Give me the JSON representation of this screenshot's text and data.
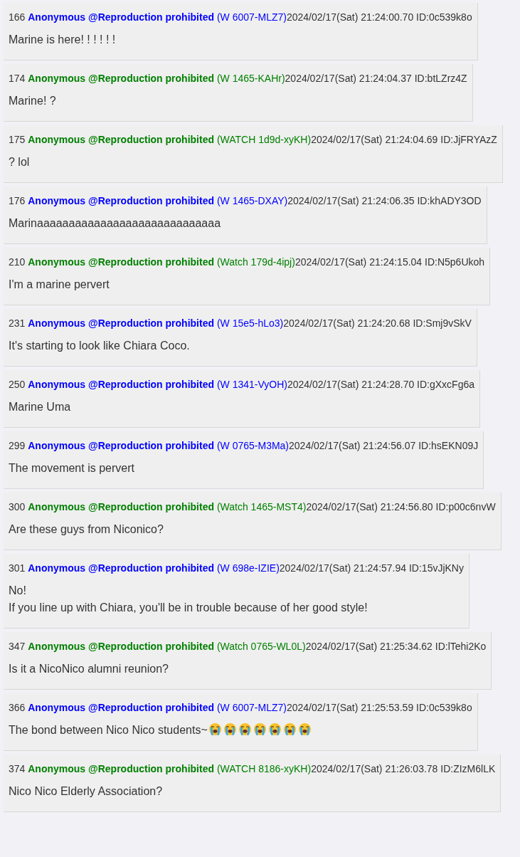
{
  "posts": [
    {
      "number": "166",
      "name": "Anonymous @Reproduction prohibited",
      "color": "#0000ff",
      "tag": "(W 6007-MLZ7)",
      "date": "2024/02/17(Sat) 21:24:00.70",
      "id": "ID:0c539k8o",
      "lines": [
        "Marine is here! ! ! ! ! !"
      ]
    },
    {
      "number": "174",
      "name": "Anonymous @Reproduction prohibited",
      "color": "#008000",
      "tag": "(W 1465-KAHr)",
      "date": "2024/02/17(Sat) 21:24:04.37",
      "id": "ID:btLZrz4Z",
      "lines": [
        "Marine! ?"
      ]
    },
    {
      "number": "175",
      "name": "Anonymous @Reproduction prohibited",
      "color": "#008000",
      "tag": "(WATCH 1d9d-xyKH)",
      "date": "2024/02/17(Sat) 21:24:04.69",
      "id": "ID:JjFRYAzZ",
      "lines": [
        "? lol"
      ]
    },
    {
      "number": "176",
      "name": "Anonymous @Reproduction prohibited",
      "color": "#0000ff",
      "tag": "(W 1465-DXAY)",
      "date": "2024/02/17(Sat) 21:24:06.35",
      "id": "ID:khADY3OD",
      "lines": [
        "Marinaaaaaaaaaaaaaaaaaaaaaaaaaaaaa"
      ]
    },
    {
      "number": "210",
      "name": "Anonymous @Reproduction prohibited",
      "color": "#008000",
      "tag": "(Watch 179d-4ipj)",
      "date": "2024/02/17(Sat) 21:24:15.04",
      "id": "ID:N5p6Ukoh",
      "lines": [
        "I'm a marine pervert"
      ]
    },
    {
      "number": "231",
      "name": "Anonymous @Reproduction prohibited",
      "color": "#0000ff",
      "tag": "(W 15e5-hLo3)",
      "date": "2024/02/17(Sat) 21:24:20.68",
      "id": "ID:Smj9vSkV",
      "lines": [
        "It's starting to look like Chiara Coco."
      ]
    },
    {
      "number": "250",
      "name": "Anonymous @Reproduction prohibited",
      "color": "#0000ff",
      "tag": "(W 1341-VyOH)",
      "date": "2024/02/17(Sat) 21:24:28.70",
      "id": "ID:gXxcFg6a",
      "lines": [
        "Marine Uma"
      ]
    },
    {
      "number": "299",
      "name": "Anonymous @Reproduction prohibited",
      "color": "#0000ff",
      "tag": "(W 0765-M3Ma)",
      "date": "2024/02/17(Sat) 21:24:56.07",
      "id": "ID:hsEKN09J",
      "lines": [
        "The movement is pervert"
      ]
    },
    {
      "number": "300",
      "name": "Anonymous @Reproduction prohibited",
      "color": "#008000",
      "tag": "(Watch 1465-MST4)",
      "date": "2024/02/17(Sat) 21:24:56.80",
      "id": "ID:p00c6nvW",
      "lines": [
        "Are these guys from Niconico?"
      ]
    },
    {
      "number": "301",
      "name": "Anonymous @Reproduction prohibited",
      "color": "#0000ff",
      "tag": "(W 698e-IZIE)",
      "date": "2024/02/17(Sat) 21:24:57.94",
      "id": "ID:15vJjKNy",
      "lines": [
        "No!",
        "If you line up with Chiara, you'll be in trouble because of her good style!"
      ]
    },
    {
      "number": "347",
      "name": "Anonymous @Reproduction prohibited",
      "color": "#008000",
      "tag": "(Watch 0765-WL0L)",
      "date": "2024/02/17(Sat) 21:25:34.62",
      "id": "ID:lTehi2Ko",
      "lines": [
        "Is it a NicoNico alumni reunion?"
      ]
    },
    {
      "number": "366",
      "name": "Anonymous @Reproduction prohibited",
      "color": "#0000ff",
      "tag": "(W 6007-MLZ7)",
      "date": "2024/02/17(Sat) 21:25:53.59",
      "id": "ID:0c539k8o",
      "lines": [
        "The bond between Nico Nico students~"
      ],
      "emoji": [
        {
          "kind": "crying"
        },
        {
          "kind": "crying"
        },
        {
          "kind": "crying"
        },
        {
          "kind": "crying"
        },
        {
          "kind": "crying"
        },
        {
          "kind": "crying"
        },
        {
          "kind": "crying"
        }
      ]
    },
    {
      "number": "374",
      "name": "Anonymous @Reproduction prohibited",
      "color": "#008000",
      "tag": "(WATCH 8186-xyKH)",
      "date": "2024/02/17(Sat) 21:26:03.78",
      "id": "ID:ZIzM6lLK",
      "lines": [
        "Nico Nico Elderly Association?"
      ]
    }
  ]
}
